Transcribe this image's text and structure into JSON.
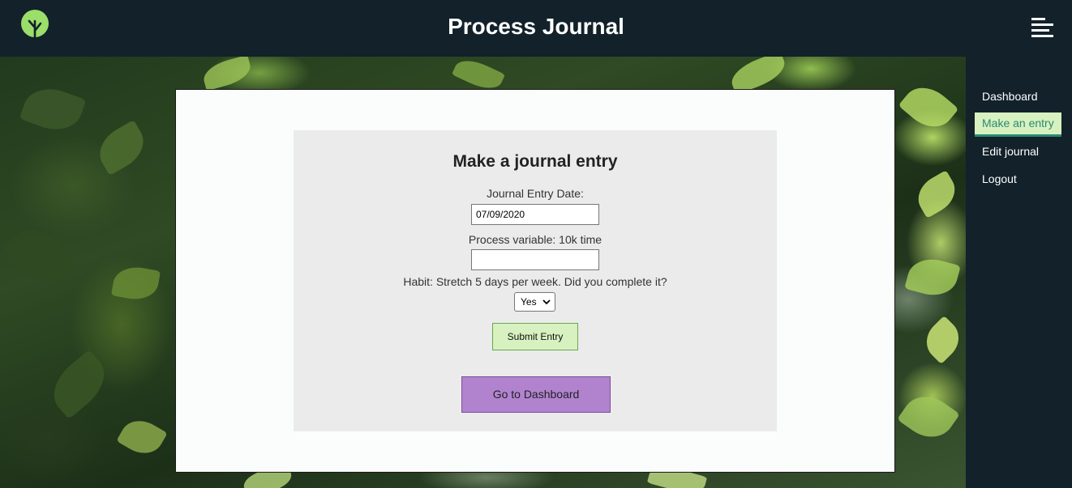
{
  "app": {
    "title": "Process Journal",
    "logo_icon": "tree-icon",
    "menu_icon": "hamburger-menu-icon"
  },
  "colors": {
    "header_bg": "#12212a",
    "accent_green": "#d7f1c0",
    "accent_teal": "#2a8a72",
    "dashboard_button": "#b183cf"
  },
  "form": {
    "title": "Make a journal entry",
    "date_label": "Journal Entry Date:",
    "date_value": "07/09/2020",
    "process_label": "Process variable: 10k time",
    "process_value": "",
    "habit_label": "Habit: Stretch 5 days per week. Did you complete it?",
    "habit_selected": "Yes",
    "submit_label": "Submit Entry",
    "dashboard_label": "Go to Dashboard"
  },
  "sidebar": {
    "items": [
      {
        "label": "Dashboard",
        "active": false
      },
      {
        "label": "Make an entry",
        "active": true
      },
      {
        "label": "Edit journal",
        "active": false
      },
      {
        "label": "Logout",
        "active": false
      }
    ]
  }
}
